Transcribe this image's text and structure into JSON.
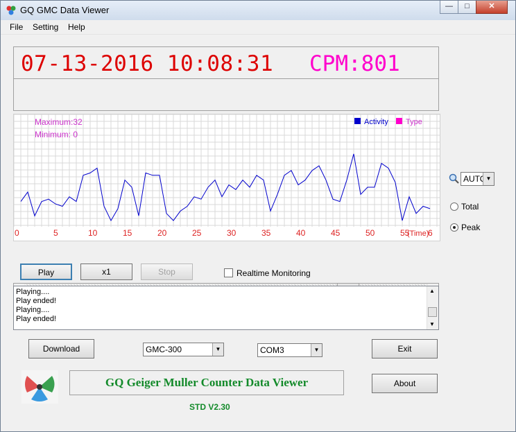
{
  "window": {
    "title": "GQ GMC Data Viewer",
    "min": "—",
    "max": "□",
    "close": "✕"
  },
  "menu": {
    "items": [
      "File",
      "Setting",
      "Help"
    ]
  },
  "status": {
    "datetime": "07-13-2016  10:08:31",
    "cpm": "CPM:801"
  },
  "chart_data": {
    "type": "line",
    "max_label": "Maximum:32",
    "min_label": "Minimum:  0",
    "legend": [
      {
        "name": "Activity",
        "color": "#0000cc"
      },
      {
        "name": "Type",
        "color": "#ff00cc"
      }
    ],
    "xlabel": "(Time)",
    "x_ticks": [
      "0",
      "5",
      "10",
      "15",
      "20",
      "25",
      "30",
      "35",
      "40",
      "45",
      "50",
      "55",
      "6"
    ],
    "x": [
      0,
      1,
      2,
      3,
      4,
      5,
      6,
      7,
      8,
      9,
      10,
      11,
      12,
      13,
      14,
      15,
      16,
      17,
      18,
      19,
      20,
      21,
      22,
      23,
      24,
      25,
      26,
      27,
      28,
      29,
      30,
      31,
      32,
      33,
      34,
      35,
      36,
      37,
      38,
      39,
      40,
      41,
      42,
      43,
      44,
      45,
      46,
      47,
      48,
      49,
      50,
      51,
      52,
      53,
      54,
      55,
      56,
      57,
      58,
      59,
      60
    ],
    "values": [
      10,
      14,
      4,
      10,
      11,
      9,
      8,
      12,
      10,
      21,
      22,
      24,
      8,
      2,
      7,
      19,
      16,
      4,
      22,
      21,
      21,
      5,
      2,
      6,
      8,
      12,
      11,
      16,
      19,
      12,
      17,
      15,
      19,
      16,
      21,
      19,
      6,
      13,
      21,
      23,
      17,
      19,
      23,
      25,
      19,
      11,
      10,
      19,
      30,
      13,
      16,
      16,
      26,
      24,
      18,
      2,
      12,
      5,
      8,
      7
    ],
    "series_color": "#0000cc",
    "ylim": [
      0,
      32
    ],
    "xlim": [
      0,
      59
    ],
    "grid": true,
    "legend_position": "top-right"
  },
  "controls": {
    "play": "Play",
    "speed": "x1",
    "stop": "Stop",
    "realtime": "Realtime Monitoring"
  },
  "log": {
    "lines": [
      "Playing....",
      "Play ended!",
      "Playing....",
      "Play ended!"
    ]
  },
  "right": {
    "scale": "AUTO",
    "total": "Total",
    "peak": "Peak",
    "selected": "Peak"
  },
  "bottom": {
    "download": "Download",
    "model": "GMC-300",
    "port": "COM3",
    "exit": "Exit",
    "about": "About",
    "banner": "GQ Geiger Muller Counter Data Viewer",
    "version": "STD V2.30"
  },
  "colors": {
    "datetime": "#dd0000",
    "cpm": "#ff00cc",
    "label_magenta": "#cc33cc",
    "axis_red": "#dd2222",
    "banner_green": "#138a2a"
  }
}
